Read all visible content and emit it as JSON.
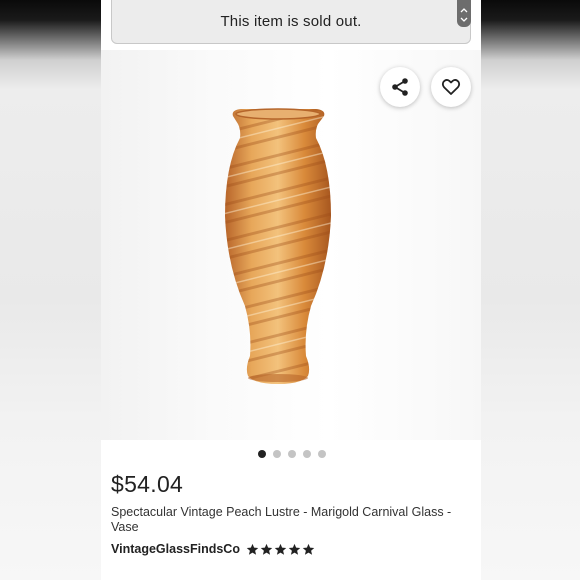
{
  "banner": {
    "text": "This item is sold out."
  },
  "listing": {
    "price": "$54.04",
    "title": "Spectacular Vintage Peach Lustre - Marigold Carnival Glass - Vase",
    "seller": "VintageGlassFindsCo",
    "rating": 5,
    "rating_max": 5,
    "image_count": 5,
    "active_image_index": 0
  },
  "icons": {
    "share": "share-icon",
    "favorite": "heart-icon",
    "rating": "star-icon"
  },
  "colors": {
    "banner_bg": "#ececec",
    "text_dark": "#222222",
    "dot_active": "#222222",
    "dot_inactive": "#c4c4c4",
    "vase_amber": "#d98a3a"
  }
}
